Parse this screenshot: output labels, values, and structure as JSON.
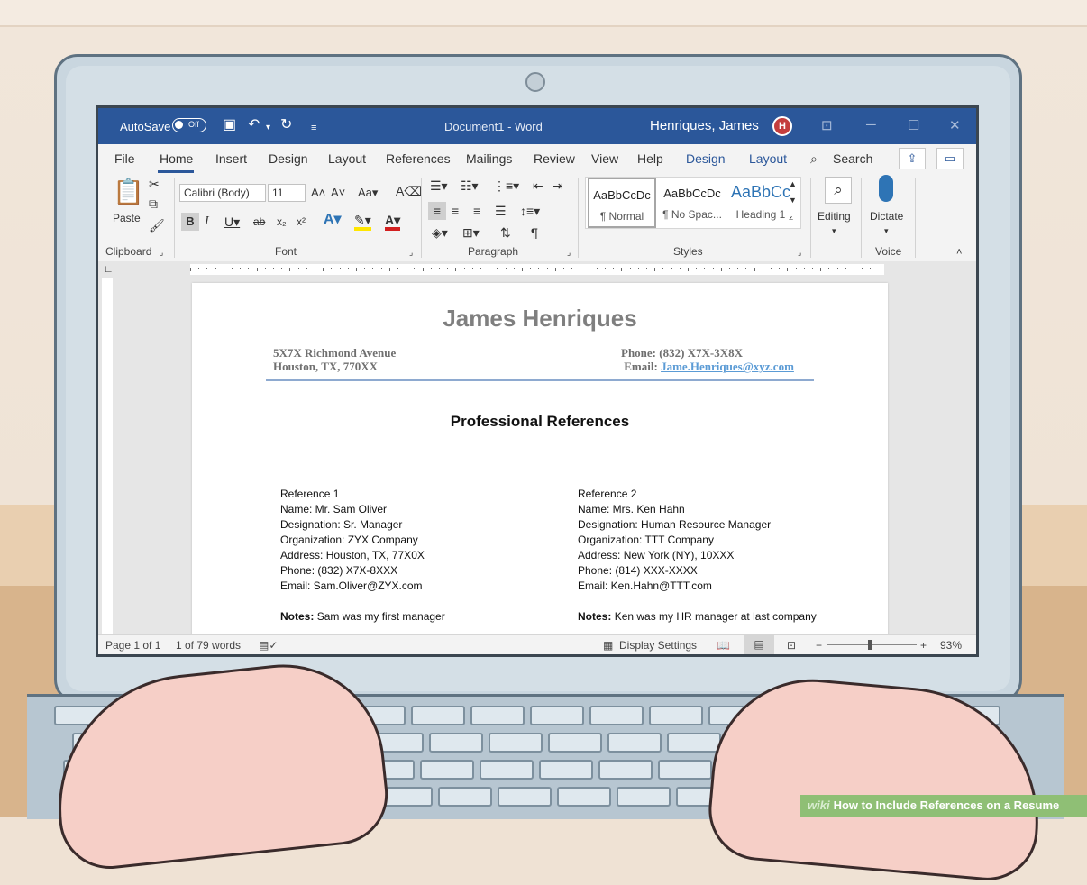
{
  "word": {
    "autosave_label": "AutoSave",
    "autosave_state": "Off",
    "document_title": "Document1 - Word",
    "user_name": "Henriques, James",
    "user_initial": "H",
    "menu_tabs": [
      "File",
      "Home",
      "Insert",
      "Design",
      "Layout",
      "References",
      "Mailings",
      "Review",
      "View",
      "Help",
      "Design",
      "Layout"
    ],
    "search_label": "Search",
    "ribbon": {
      "paste_label": "Paste",
      "font_name": "Calibri (Body)",
      "font_size": "11",
      "group_clipboard": "Clipboard",
      "group_font": "Font",
      "group_paragraph": "Paragraph",
      "group_styles": "Styles",
      "group_voice": "Voice",
      "editing_label": "Editing",
      "dictate_label": "Dictate",
      "styles": [
        {
          "preview": "AaBbCcDc",
          "name": "¶ Normal"
        },
        {
          "preview": "AaBbCcDc",
          "name": "¶ No Spac..."
        },
        {
          "preview": "AaBbCc",
          "name": "Heading 1"
        }
      ]
    },
    "status": {
      "page": "Page 1 of 1",
      "words": "1 of 79 words",
      "display_settings": "Display Settings",
      "zoom": "93%",
      "zoom_level": 0.46
    }
  },
  "resume": {
    "name": "James Henriques",
    "address_line1": "5X7X Richmond Avenue",
    "address_line2": "Houston, TX, 770XX",
    "phone": "Phone: (832) X7X-3X8X",
    "email_label": "Email:",
    "email": "Jame.Henriques@xyz.com",
    "heading": "Professional References",
    "references": [
      {
        "title": "Reference 1",
        "name": "Name: Mr. Sam Oliver",
        "designation": "Designation: Sr. Manager",
        "organization": "Organization: ZYX Company",
        "address": "Address: Houston, TX, 77X0X",
        "phone": "Phone: (832) X7X-8XXX",
        "email": "Email: Sam.Oliver@ZYX.com",
        "notes_label": "Notes:",
        "notes": "Sam was my first manager"
      },
      {
        "title": "Reference 2",
        "name": "Name: Mrs. Ken Hahn",
        "designation": "Designation: Human Resource Manager",
        "organization": "Organization: TTT Company",
        "address": "Address: New York (NY), 10XXX",
        "phone": "Phone: (814) XXX-XXXX",
        "email": "Email: Ken.Hahn@TTT.com",
        "notes_label": "Notes:",
        "notes": "Ken was my HR manager at last company"
      }
    ]
  },
  "caption": {
    "wiki": "wiki",
    "title": "How to Include References on a Resume"
  },
  "colors": {
    "word_blue": "#2b579a",
    "caption_green": "#8fbf75",
    "link_blue": "#5b9bd5"
  }
}
